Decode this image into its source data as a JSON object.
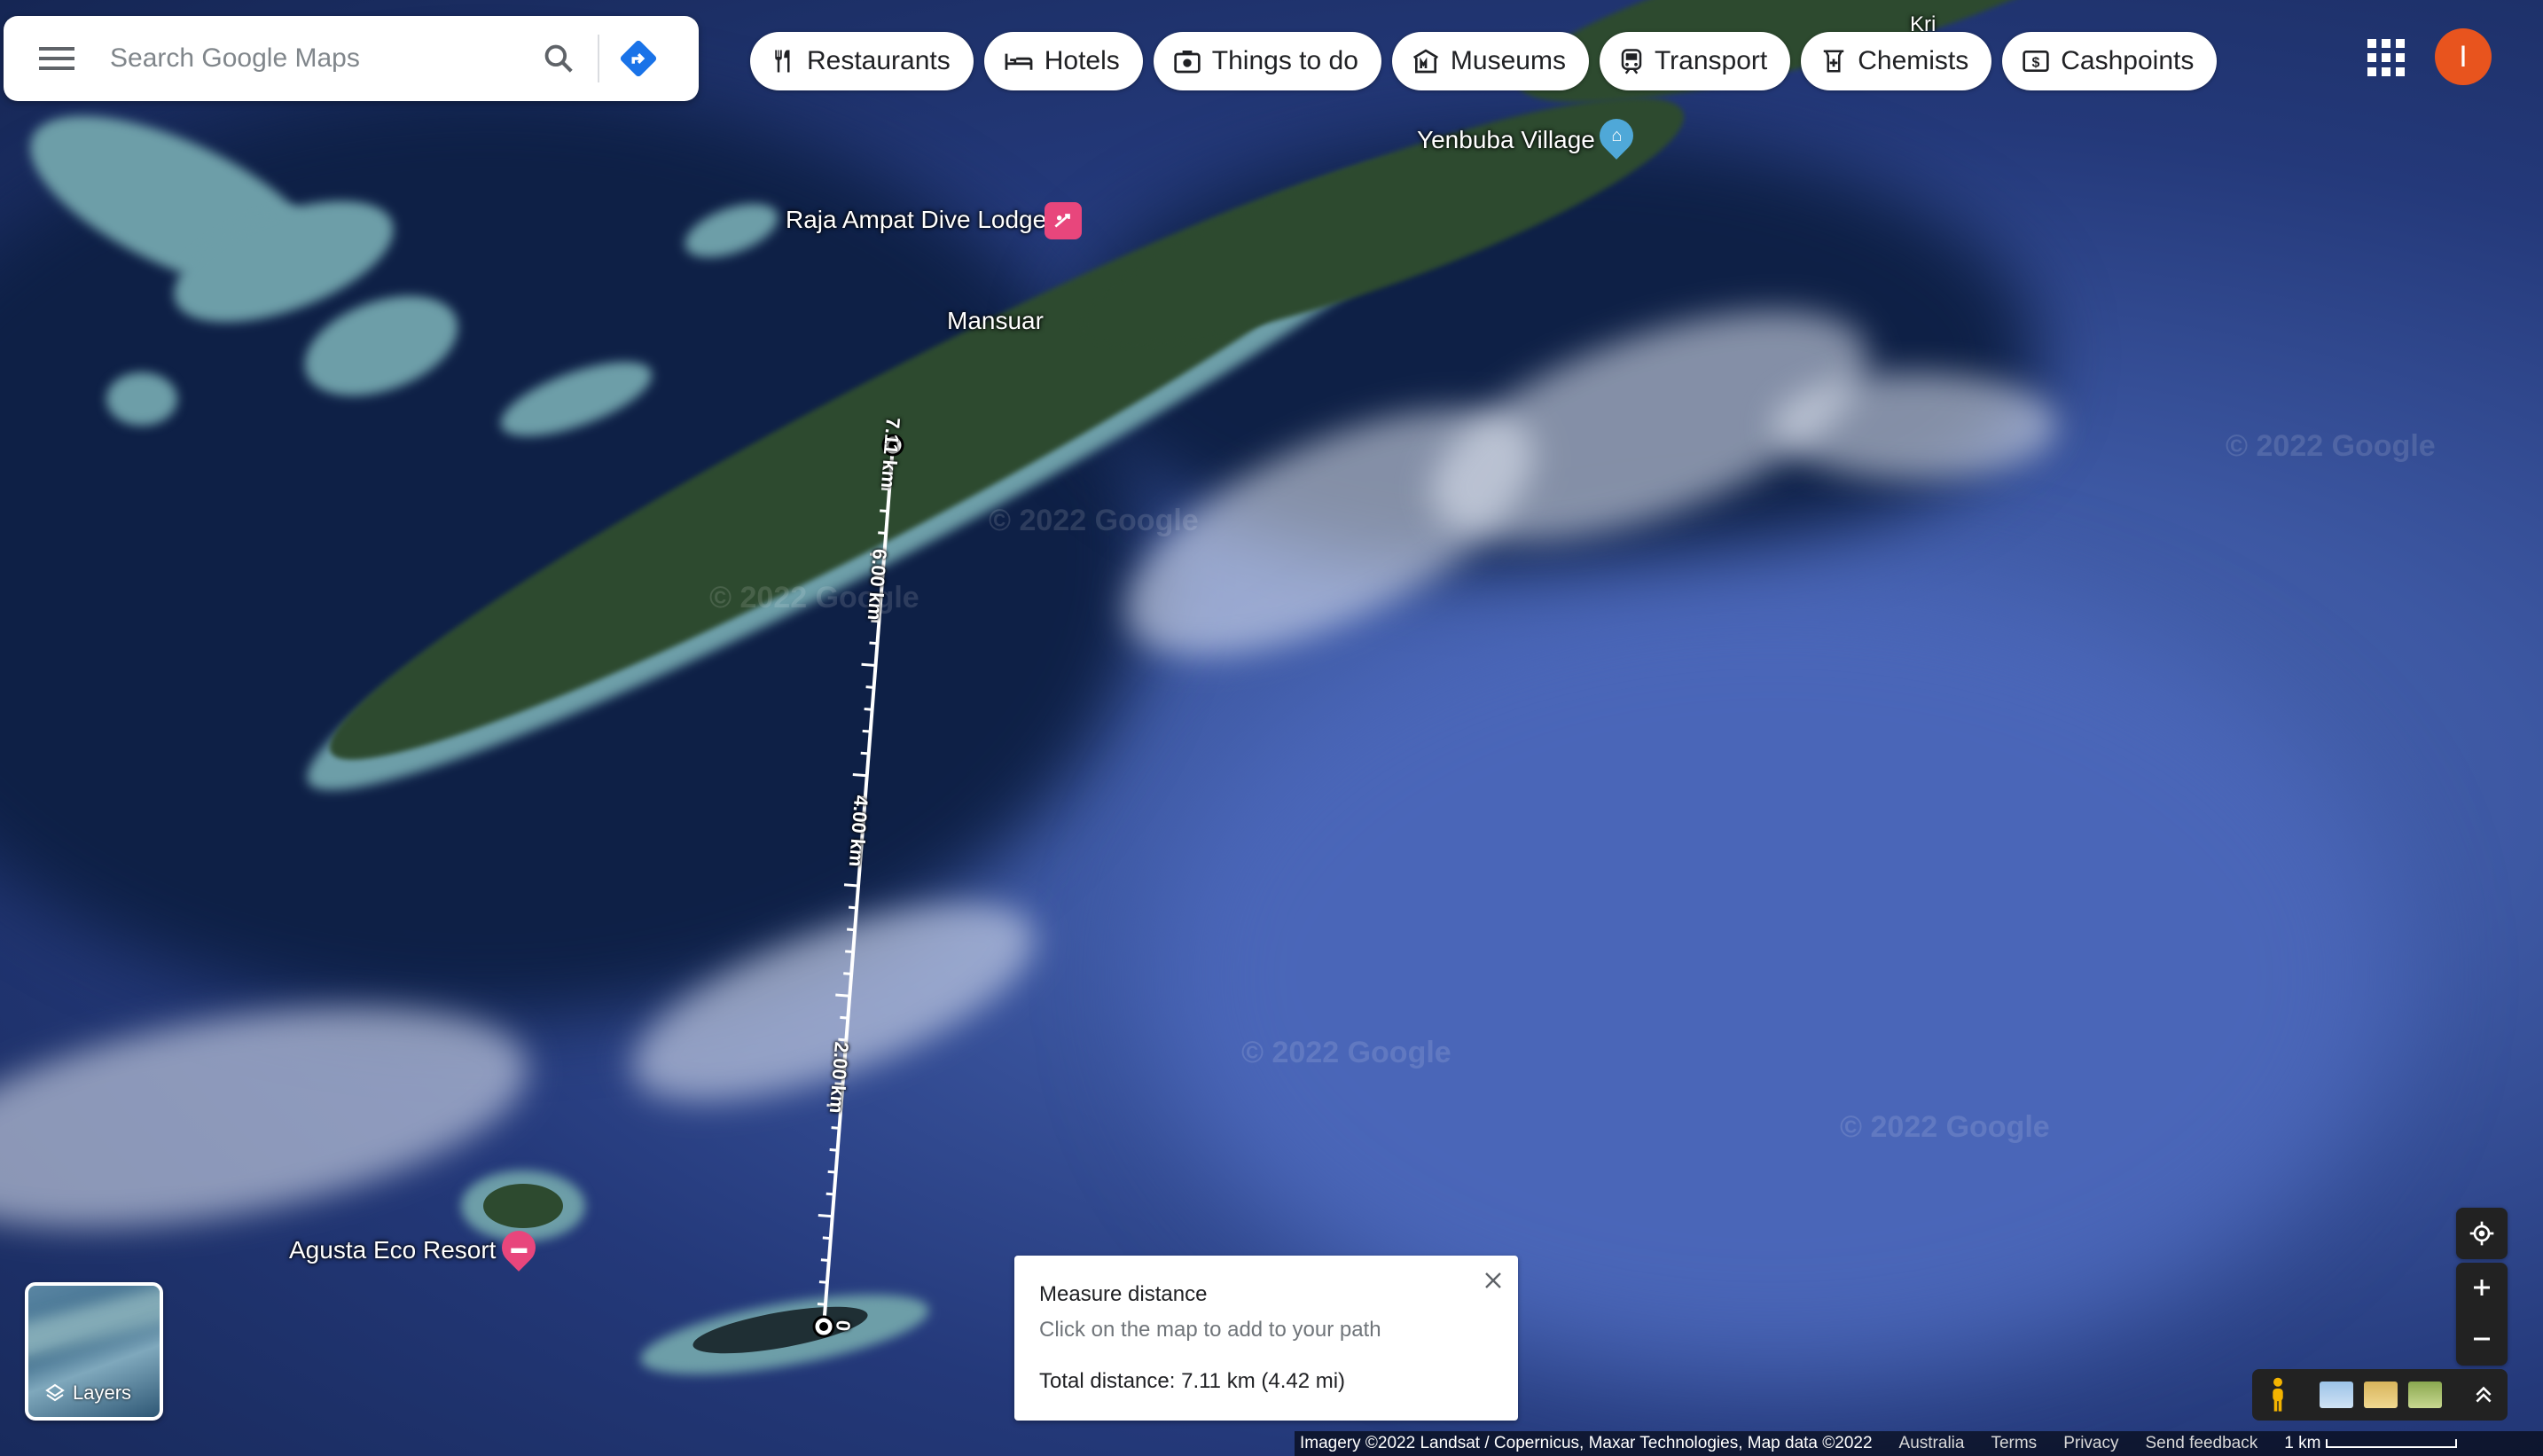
{
  "search": {
    "placeholder": "Search Google Maps"
  },
  "icons": {
    "menu": "menu-icon",
    "search": "search-icon",
    "directions": "directions-icon",
    "apps": "apps-grid-icon",
    "close": "close-icon",
    "layers": "layers-icon",
    "locate": "my-location-icon",
    "pegman": "pegman-icon"
  },
  "chips": [
    {
      "label": "Restaurants",
      "icon": "restaurant-icon"
    },
    {
      "label": "Hotels",
      "icon": "hotel-icon"
    },
    {
      "label": "Things to do",
      "icon": "camera-icon"
    },
    {
      "label": "Museums",
      "icon": "museum-icon"
    },
    {
      "label": "Transport",
      "icon": "train-icon"
    },
    {
      "label": "Chemists",
      "icon": "pharmacy-icon"
    },
    {
      "label": "Cashpoints",
      "icon": "atm-icon"
    }
  ],
  "account": {
    "initial": "I",
    "color": "#e8541e"
  },
  "map": {
    "places": {
      "kri": "Kri",
      "yenbuba": "Yenbuba Village",
      "dive_lodge": "Raja Ampat Dive Lodge",
      "mansuar": "Mansuar",
      "agusta": "Agusta Eco Resort"
    },
    "watermark": "© 2022 Google",
    "measure_labels": {
      "end": "7.11 km",
      "six": "6.00 km",
      "four": "4.00 km",
      "two": "2.00 km",
      "start": "0"
    }
  },
  "measure": {
    "title": "Measure distance",
    "hint": "Click on the map to add to your path",
    "total": "Total distance: 7.11 km (4.42 mi)"
  },
  "layers": {
    "label": "Layers"
  },
  "footer": {
    "attribution": "Imagery ©2022 Landsat / Copernicus, Maxar Technologies, Map data ©2022",
    "region": "Australia",
    "terms": "Terms",
    "privacy": "Privacy",
    "feedback": "Send feedback",
    "scale": "1 km"
  },
  "colors": {
    "accent_blue": "#1a73e8",
    "hotel_pin": "#e8467c",
    "village_pin": "#4fa8d8",
    "avatar": "#e8541e"
  }
}
